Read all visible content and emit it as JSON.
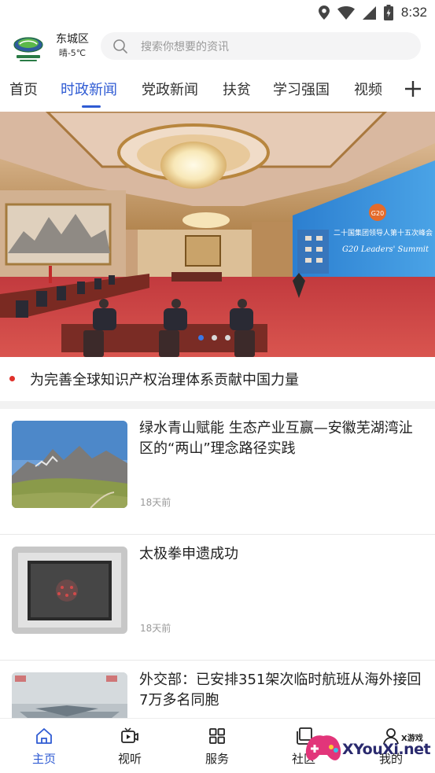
{
  "status_bar": {
    "time": "8:32"
  },
  "header": {
    "district": "东城区",
    "weather": "晴-5℃",
    "search_placeholder": "搜索你想要的资讯"
  },
  "tabs": [
    "首页",
    "时政新闻",
    "党政新闻",
    "扶贫",
    "学习强国",
    "视频"
  ],
  "active_tab": "时政新闻",
  "banner": {
    "slide_count": 3,
    "active_slide": 1,
    "screen_text_cn": "二十国集团领导人第十五次峰会",
    "screen_text_en": "G20 Leaders' Summit",
    "screen_logo": "G20",
    "headline": "为完善全球知识产权治理体系贡献中国力量"
  },
  "news": [
    {
      "title": "绿水青山赋能  生态产业互赢—安徽芜湖湾沚区的“两山”理念路径实践",
      "time": "18天前",
      "thumb": "mountain-landscape"
    },
    {
      "title": "太极拳申遗成功",
      "time": "18天前",
      "thumb": "stone-well"
    },
    {
      "title": "外交部：已安排351架次临时航班从海外接回7万多名同胞",
      "time": "",
      "thumb": "airplane"
    }
  ],
  "bottom_nav": [
    {
      "label": "主页",
      "icon": "home-icon",
      "active": true
    },
    {
      "label": "视听",
      "icon": "video-icon",
      "active": false
    },
    {
      "label": "服务",
      "icon": "grid-icon",
      "active": false
    },
    {
      "label": "社区",
      "icon": "community-icon",
      "active": false
    },
    {
      "label": "我的",
      "icon": "profile-icon",
      "active": false
    }
  ],
  "watermark": {
    "text": "XYouXi.net",
    "small": "X游戏"
  },
  "colors": {
    "accent": "#2f5bd3",
    "red_dot": "#e0312a"
  }
}
